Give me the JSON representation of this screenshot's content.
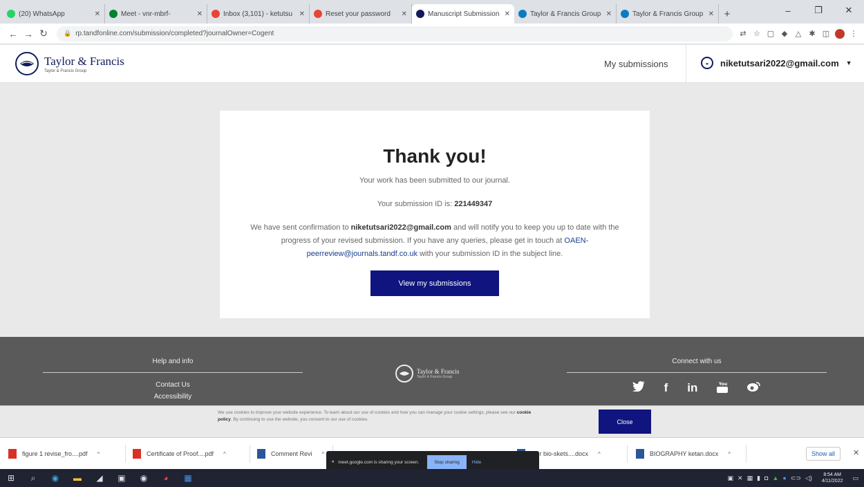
{
  "browser": {
    "tabs": [
      {
        "title": "(20) WhatsApp",
        "favicon_color": "#25d366",
        "active": false
      },
      {
        "title": "Meet - vnr-mbrf-",
        "favicon_color": "#00832d",
        "active": false
      },
      {
        "title": "Inbox (3,101) - ketutsu",
        "favicon_color": "#ea4335",
        "active": false
      },
      {
        "title": "Reset your password",
        "favicon_color": "#ea4335",
        "active": false
      },
      {
        "title": "Manuscript Submission",
        "favicon_color": "#0f1b5c",
        "active": true
      },
      {
        "title": "Taylor & Francis Group",
        "favicon_color": "#0a7cc1",
        "active": false
      },
      {
        "title": "Taylor & Francis Group",
        "favicon_color": "#0a7cc1",
        "active": false
      }
    ],
    "new_tab": "+",
    "url": "rp.tandfonline.com/submission/completed?journalOwner=Cogent",
    "window_controls": {
      "minimize": "–",
      "maximize": "❐",
      "close": "✕"
    }
  },
  "header": {
    "logo_title": "Taylor & Francis",
    "logo_subtitle": "Taylor & Francis Group",
    "my_submissions": "My submissions",
    "user_email": "niketutsari2022@gmail.com"
  },
  "card": {
    "heading": "Thank you!",
    "line1": "Your work has been submitted to our journal.",
    "id_label": "Your submission ID is:",
    "submission_id": "221449347",
    "para_1": "We have sent confirmation to",
    "para_email": "niketutsari2022@gmail.com",
    "para_2": "and will notify you to keep you up to date with the progress of your revised submission. If you have any queries, please get in touch at",
    "contact_email": "OAEN-peerreview@journals.tandf.co.uk",
    "para_3": "with your submission ID in the subject line.",
    "button": "View my submissions"
  },
  "footer": {
    "help_heading": "Help and info",
    "contact_us": "Contact Us",
    "accessibility": "Accessibility",
    "logo_title": "Taylor & Francis",
    "logo_subtitle": "Taylor & Francis Group",
    "connect_heading": "Connect with us",
    "social": [
      "twitter",
      "facebook",
      "linkedin",
      "youtube",
      "weibo"
    ]
  },
  "cookie": {
    "text_1": "We use cookies to improve your website experience. To learn about our use of cookies and how you can manage your cookie settings, please see our",
    "policy": "cookie policy",
    "text_2": ". By continuing to use the website, you consent to our use of cookies.",
    "close": "Close"
  },
  "downloads": {
    "items": [
      {
        "name": "figure 1 revise_fro....pdf",
        "type": "pdf"
      },
      {
        "name": "Certificate of Proof....pdf",
        "type": "pdf"
      },
      {
        "name": "Comment Revi",
        "type": "doc"
      },
      {
        "name": "thor bio-skets....docx",
        "type": "doc"
      },
      {
        "name": "BIOGRAPHY ketan.docx",
        "type": "doc"
      }
    ],
    "show_all": "Show all"
  },
  "screen_share": {
    "text": "meet.google.com is sharing your screen.",
    "stop": "Stop sharing",
    "hide": "Hide"
  },
  "taskbar": {
    "time": "8:54 AM",
    "date": "4/11/2022"
  }
}
